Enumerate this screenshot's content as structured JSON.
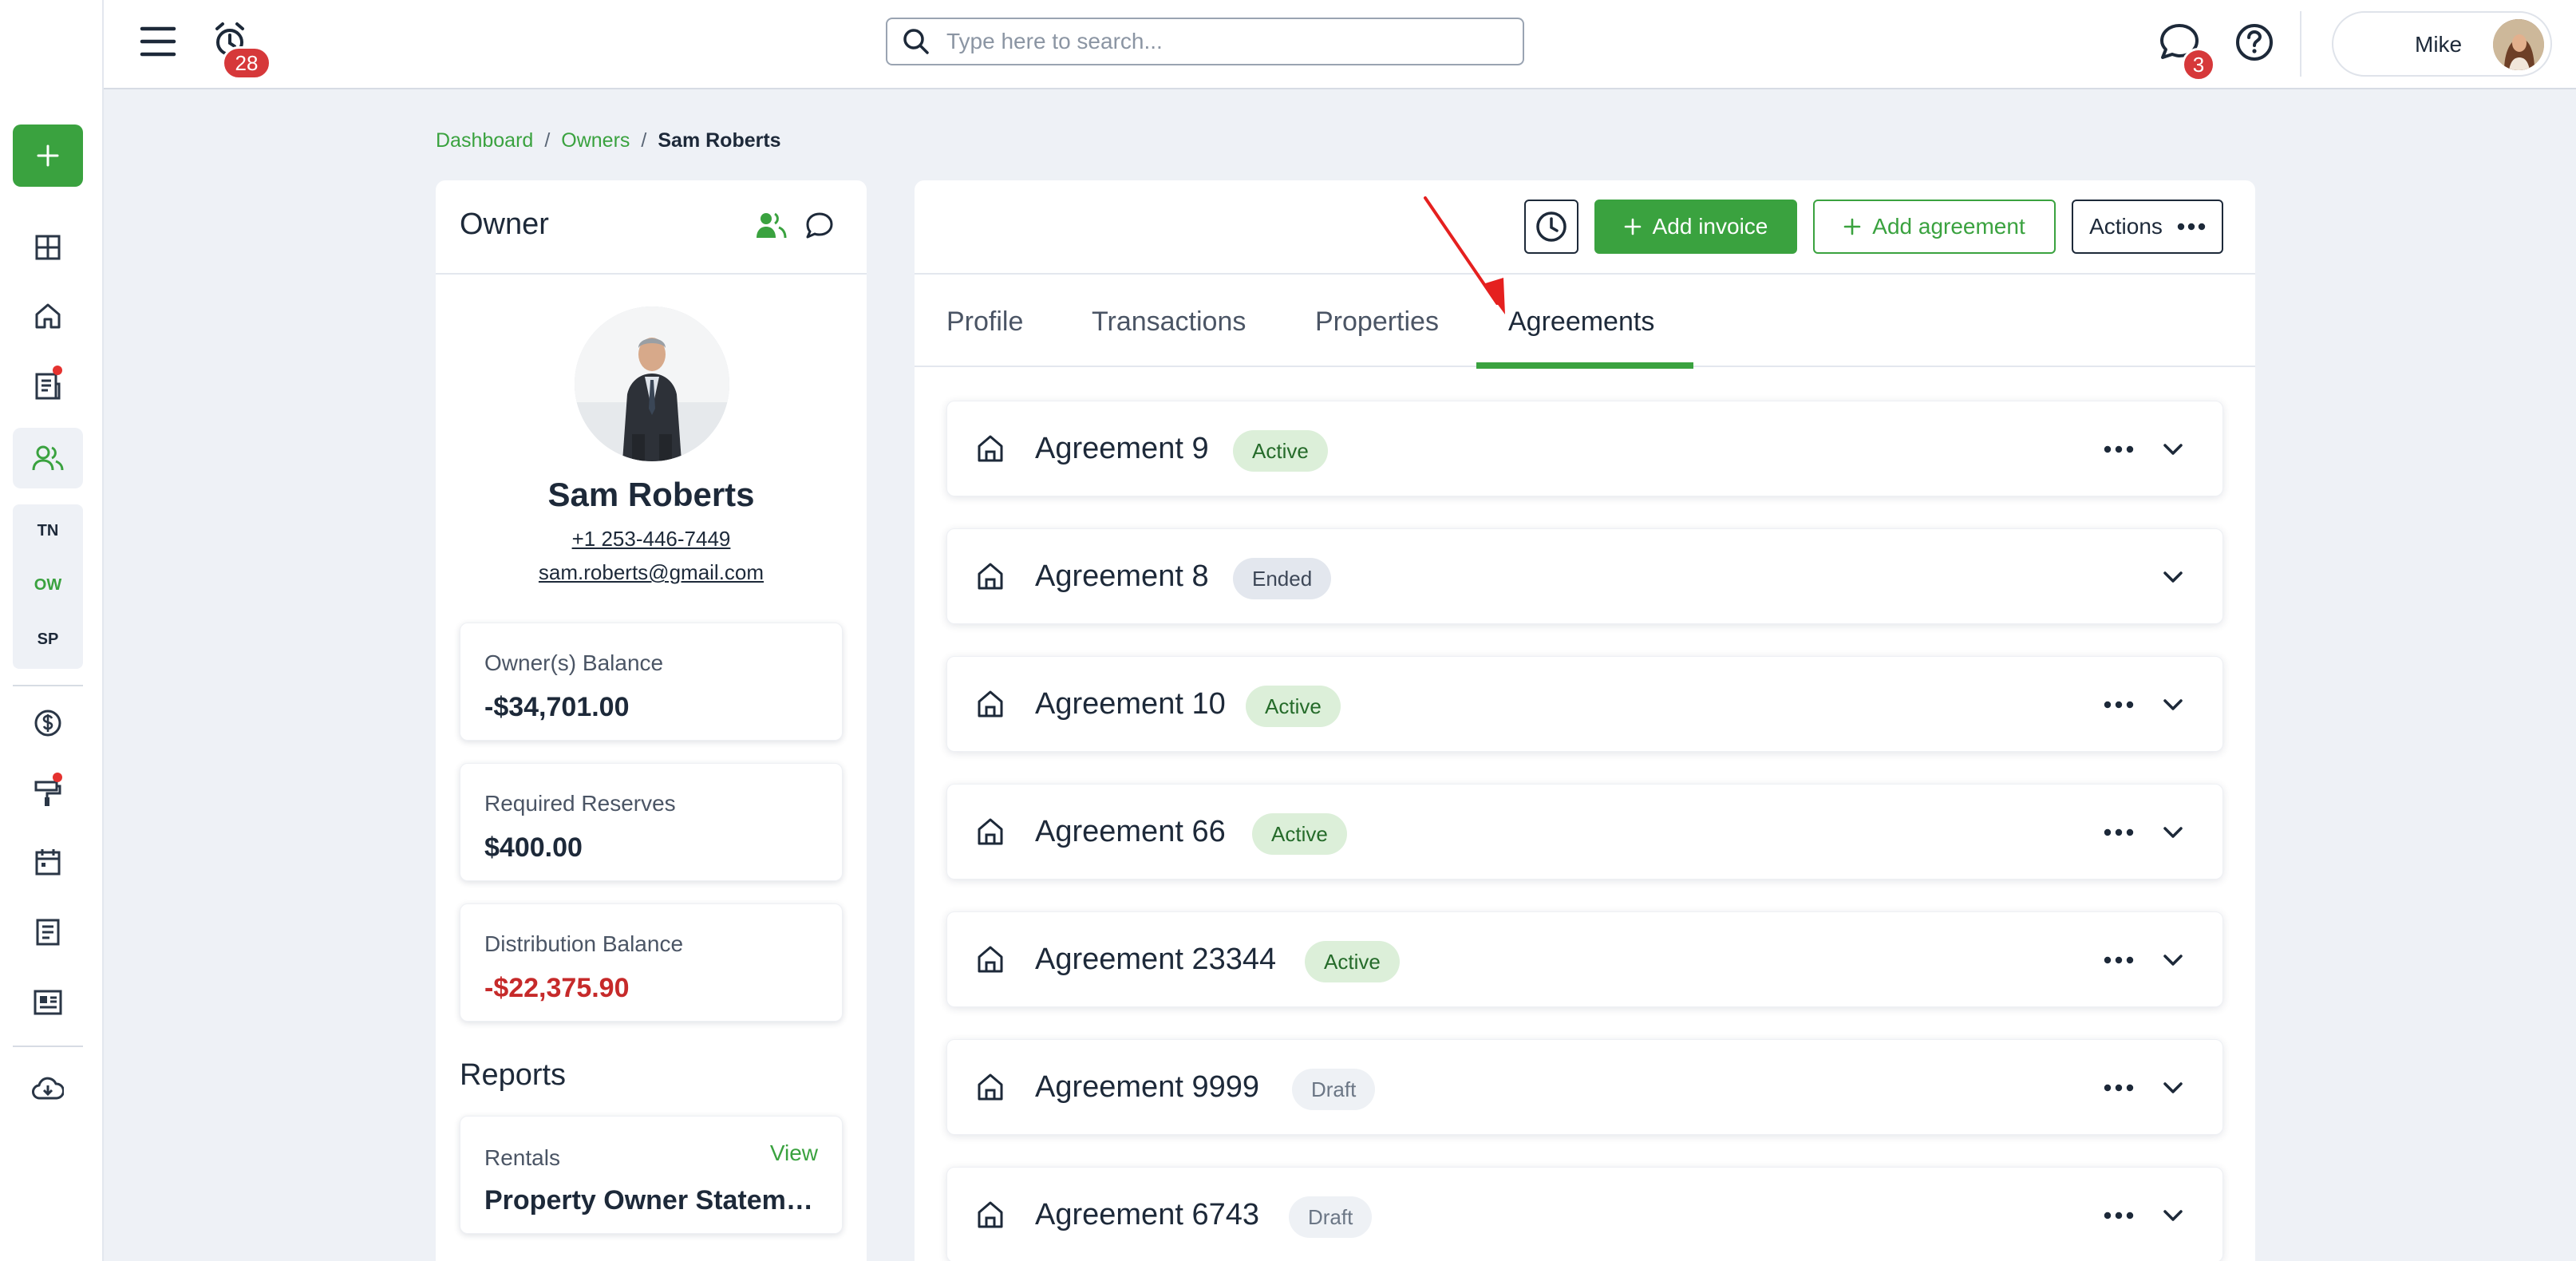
{
  "rail": {
    "abbr": [
      "TN",
      "OW",
      "SP"
    ]
  },
  "topbar": {
    "notifications_count": "28",
    "search_placeholder": "Type here to search...",
    "messages_count": "3",
    "user_name": "Mike"
  },
  "breadcrumb": {
    "items": [
      "Dashboard",
      "Owners"
    ],
    "current": "Sam Roberts"
  },
  "owner": {
    "card_title": "Owner",
    "name": "Sam Roberts",
    "phone": "+1 253-446-7449",
    "email": "sam.roberts@gmail.com",
    "stats": [
      {
        "label": "Owner(s) Balance",
        "value": "-$34,701.00"
      },
      {
        "label": "Required Reserves",
        "value": "$400.00"
      },
      {
        "label": "Distribution Balance",
        "value": "-$22,375.90"
      }
    ],
    "reports_title": "Reports",
    "report": {
      "label": "Rentals",
      "view": "View",
      "name": "Property Owner Statement"
    }
  },
  "toolbar": {
    "add_invoice": "Add invoice",
    "add_agreement": "Add agreement",
    "actions": "Actions"
  },
  "tabs": [
    "Profile",
    "Transactions",
    "Properties",
    "Agreements"
  ],
  "active_tab": "Agreements",
  "agreements": [
    {
      "title": "Agreement 9",
      "status": "Active"
    },
    {
      "title": "Agreement 8",
      "status": "Ended"
    },
    {
      "title": "Agreement 10",
      "status": "Active"
    },
    {
      "title": "Agreement 66",
      "status": "Active"
    },
    {
      "title": "Agreement 23344",
      "status": "Active"
    },
    {
      "title": "Agreement 9999",
      "status": "Draft"
    },
    {
      "title": "Agreement 6743",
      "status": "Draft"
    }
  ],
  "colors": {
    "accent": "#3aa23f",
    "badge": "#d6383a",
    "negative": "#c62a2a",
    "annotation": "#e5201f"
  }
}
